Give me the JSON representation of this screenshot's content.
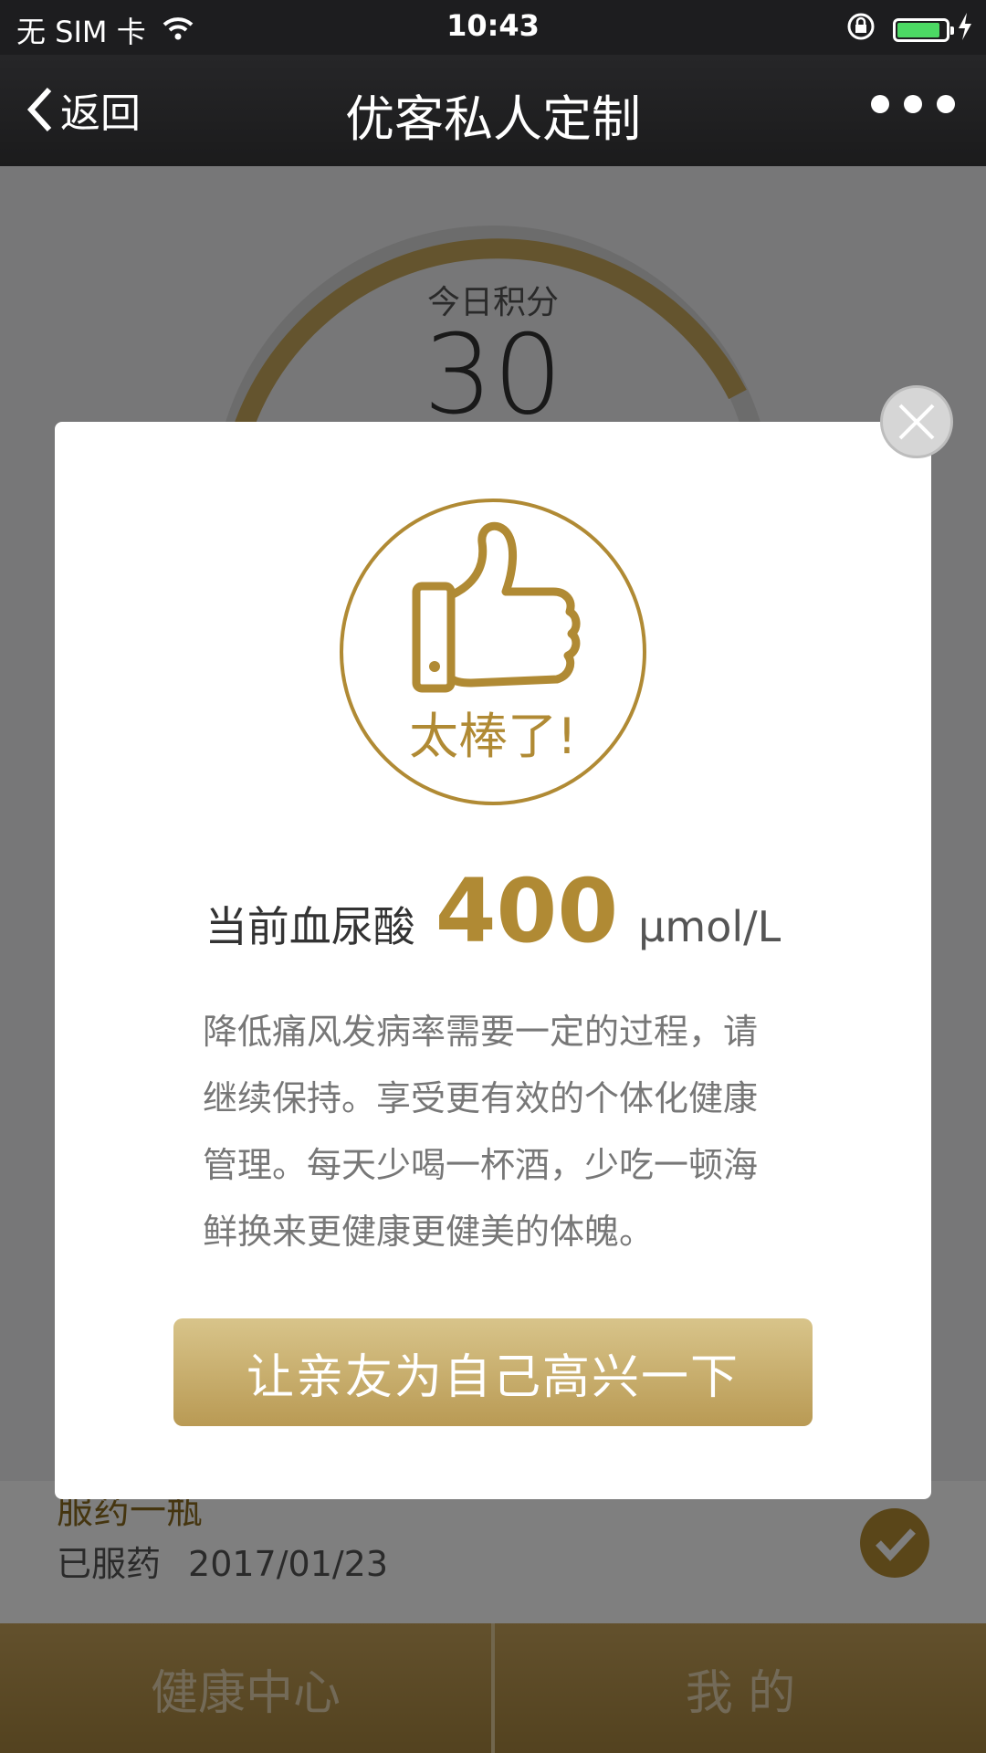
{
  "status_bar": {
    "carrier": "无 SIM 卡",
    "time": "10:43",
    "battery_level": 0.9
  },
  "nav": {
    "back_label": "返回",
    "title": "优客私人定制"
  },
  "score": {
    "label": "今日积分",
    "value": "30"
  },
  "task": {
    "title": "服药一瓶",
    "status": "已服药",
    "date": "2017/01/23"
  },
  "tabs": [
    {
      "label": "健康中心"
    },
    {
      "label": "我 的"
    }
  ],
  "modal": {
    "badge_text": "太棒了!",
    "reading_label": "当前血尿酸",
    "reading_value": "400",
    "reading_unit": "μmol/L",
    "message": "降低痛风发病率需要一定的过程，请继续保持。享受更有效的个体化健康管理。每天少喝一杯酒，少吃一顿海鲜换来更健康更健美的体魄。",
    "cta_label": "让亲友为自己高兴一下"
  },
  "colors": {
    "accent_gold": "#b08a34",
    "battery_green": "#4cd964"
  }
}
